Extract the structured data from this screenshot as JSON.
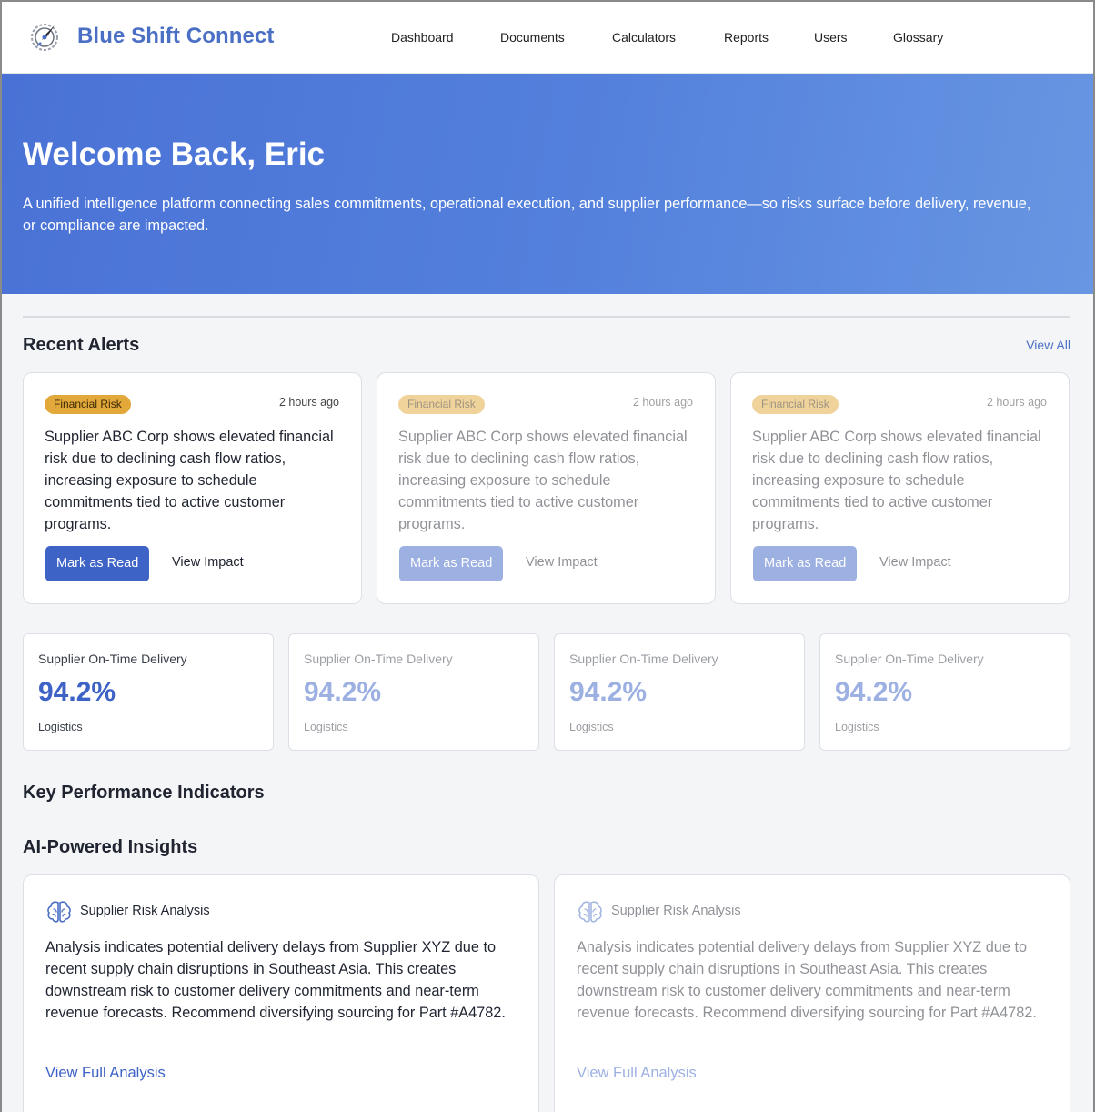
{
  "brand": {
    "name": "Blue Shift Connect",
    "logo_icon": "rocket-compass-icon"
  },
  "nav": [
    {
      "label": "Dashboard"
    },
    {
      "label": "Documents"
    },
    {
      "label": "Calculators"
    },
    {
      "label": "Reports"
    },
    {
      "label": "Users"
    },
    {
      "label": "Glossary"
    }
  ],
  "hero": {
    "title": "Welcome Back, Eric",
    "text": "A unified intelligence platform connecting sales commitments, operational execution, and supplier performance—so risks surface before delivery, revenue, or compliance are impacted."
  },
  "alerts_section": {
    "title": "Recent Alerts",
    "view_all": "View All",
    "items": [
      {
        "badge": "Financial Risk",
        "time": "2 hours ago",
        "body": "Supplier ABC Corp shows elevated financial risk due to declining cash flow ratios, increasing exposure to schedule commitments tied to active customer programs.",
        "primary_action": "Mark as Read",
        "secondary_action": "View Impact"
      },
      {
        "badge": "Financial Risk",
        "time": "2 hours ago",
        "body": "Supplier ABC Corp shows elevated financial risk due to declining cash flow ratios, increasing exposure to schedule commitments tied to active customer programs.",
        "primary_action": "Mark as Read",
        "secondary_action": "View Impact"
      },
      {
        "badge": "Financial Risk",
        "time": "2 hours ago",
        "body": "Supplier ABC Corp shows elevated financial risk due to declining cash flow ratios, increasing exposure to schedule commitments tied to active customer programs.",
        "primary_action": "Mark as Read",
        "secondary_action": "View Impact"
      }
    ]
  },
  "metrics": [
    {
      "label": "Supplier On-Time Delivery",
      "value": "94.2%",
      "category": "Logistics"
    },
    {
      "label": "Supplier On-Time Delivery",
      "value": "94.2%",
      "category": "Logistics"
    },
    {
      "label": "Supplier On-Time Delivery",
      "value": "94.2%",
      "category": "Logistics"
    },
    {
      "label": "Supplier On-Time Delivery",
      "value": "94.2%",
      "category": "Logistics"
    }
  ],
  "kpi_section": {
    "title": "Key Performance Indicators"
  },
  "insights_section": {
    "title": "AI-Powered Insights",
    "items": [
      {
        "icon": "brain-icon",
        "title": "Supplier Risk Analysis",
        "body": "Analysis indicates potential delivery delays from Supplier XYZ due to recent supply chain disruptions in Southeast Asia. This creates downstream risk to customer delivery commitments and near-term revenue forecasts. Recommend diversifying sourcing for Part #A4782.",
        "link": "View Full Analysis"
      },
      {
        "icon": "brain-icon",
        "title": "Supplier Risk Analysis",
        "body": "Analysis indicates potential delivery delays from Supplier XYZ due to recent supply chain disruptions in Southeast Asia. This creates downstream risk to customer delivery commitments and near-term revenue forecasts. Recommend diversifying sourcing for Part #A4782.",
        "link": "View Full Analysis"
      }
    ]
  },
  "colors": {
    "brand": "#4a6fc4",
    "primary": "#3e63c6",
    "hero_start": "#4a72d6",
    "hero_end": "#6896e2",
    "badge": "#e3a83a",
    "background": "#f4f5f7"
  }
}
